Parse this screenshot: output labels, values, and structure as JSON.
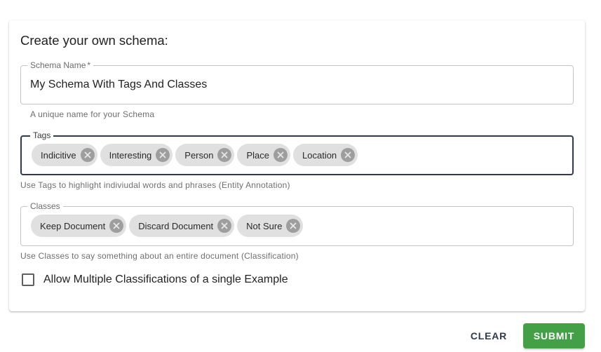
{
  "form": {
    "title": "Create your own schema:",
    "schema_name": {
      "label": "Schema Name",
      "required_mark": "*",
      "value": "My Schema With Tags And Classes",
      "helper": "A unique name for your Schema"
    },
    "tags": {
      "label": "Tags",
      "chips": [
        "Indicitive",
        "Interesting",
        "Person",
        "Place",
        "Location"
      ],
      "helper": "Use Tags to highlight indiviudal words and phrases (Entity Annotation)"
    },
    "classes": {
      "label": "Classes",
      "chips": [
        "Keep Document",
        "Discard Document",
        "Not Sure"
      ],
      "helper": "Use Classes to say something about an entire document (Classification)"
    },
    "multi_class": {
      "label": "Allow Multiple Classifications of a single Example",
      "checked": false
    }
  },
  "actions": {
    "clear_label": "CLEAR",
    "submit_label": "SUBMIT"
  },
  "icons": {
    "chip_delete": "cancel-circle-icon",
    "checkbox": "checkbox-unchecked-icon"
  },
  "colors": {
    "submit": "#43a047",
    "focused_border": "#2f3a4d",
    "chip_bg": "#e0e0e0"
  }
}
